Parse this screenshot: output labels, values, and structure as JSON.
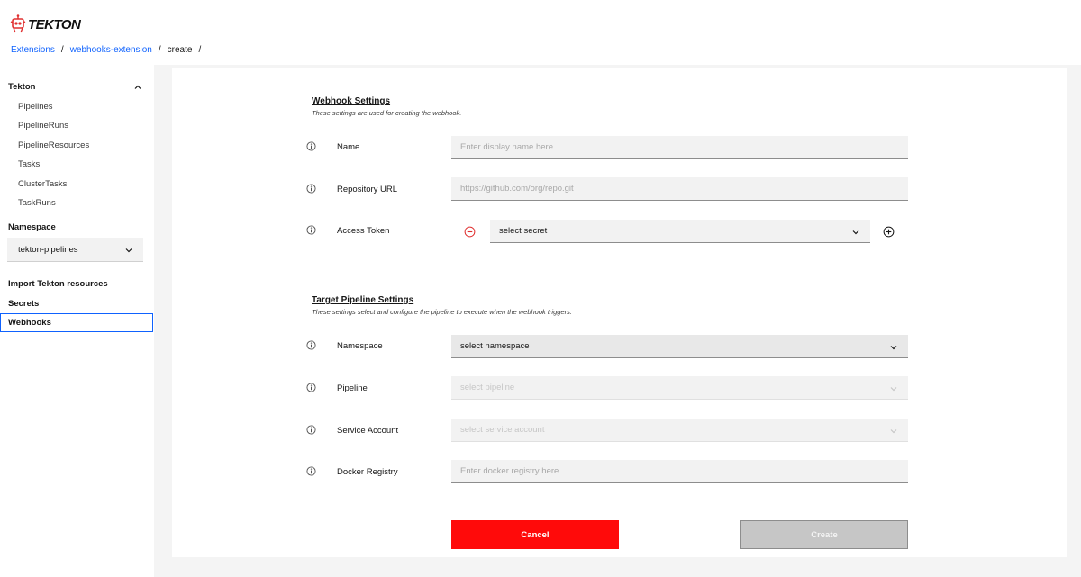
{
  "header": {
    "logo_text": "TEKTON",
    "breadcrumb": [
      "Extensions",
      "webhooks-extension",
      "create"
    ]
  },
  "sidebar": {
    "section_tekton": "Tekton",
    "items": [
      "Pipelines",
      "PipelineRuns",
      "PipelineResources",
      "Tasks",
      "ClusterTasks",
      "TaskRuns"
    ],
    "namespace_label": "Namespace",
    "namespace_value": "tekton-pipelines",
    "import_label": "Import Tekton resources",
    "secrets_label": "Secrets",
    "webhooks_label": "Webhooks"
  },
  "webhook_settings": {
    "title": "Webhook Settings",
    "subtitle": "These settings are used for creating the webhook.",
    "name_label": "Name",
    "name_placeholder": "Enter display name here",
    "repo_label": "Repository URL",
    "repo_placeholder": "https://github.com/org/repo.git",
    "token_label": "Access Token",
    "token_select": "select secret"
  },
  "target_settings": {
    "title": "Target Pipeline Settings",
    "subtitle": "These settings select and configure the pipeline to execute when the webhook triggers.",
    "namespace_label": "Namespace",
    "namespace_select": "select namespace",
    "pipeline_label": "Pipeline",
    "pipeline_select": "select pipeline",
    "sa_label": "Service Account",
    "sa_select": "select service account",
    "docker_label": "Docker Registry",
    "docker_placeholder": "Enter docker registry here"
  },
  "buttons": {
    "cancel": "Cancel",
    "create": "Create"
  },
  "colors": {
    "accent": "#0f62fe",
    "danger": "#ff0a0a"
  }
}
